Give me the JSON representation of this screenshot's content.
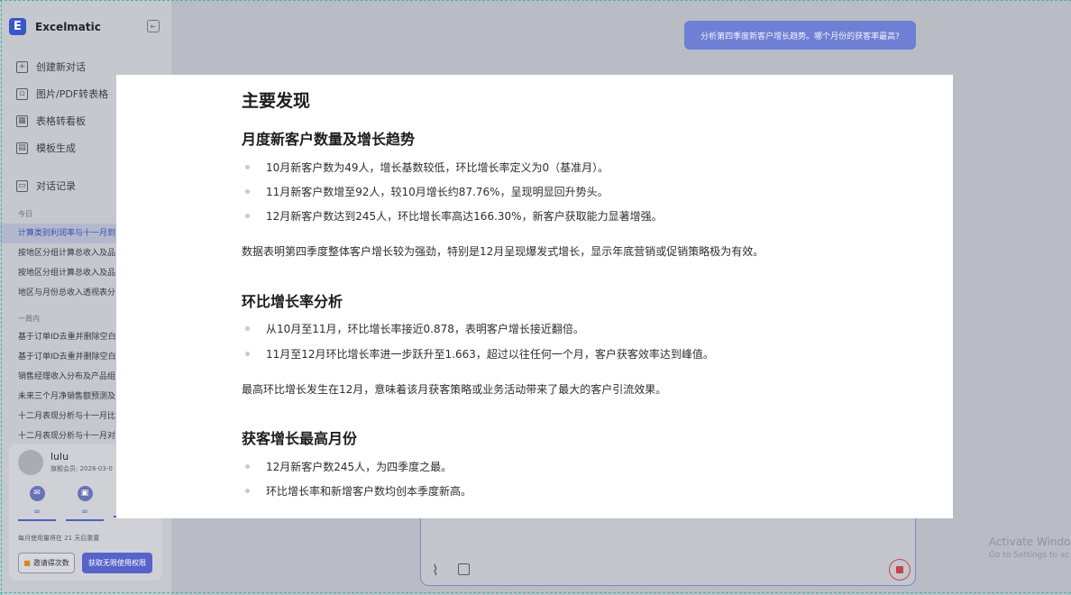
{
  "app": {
    "name": "Excelmatic",
    "logo_letter": "E"
  },
  "sidebar": {
    "menu": [
      {
        "icon": "plus-square-icon",
        "label": "创建新对话"
      },
      {
        "icon": "image-icon",
        "label": "图片/PDF转表格"
      },
      {
        "icon": "dashboard-icon",
        "label": "表格转看板"
      },
      {
        "icon": "template-icon",
        "label": "模板生成"
      }
    ],
    "history_title": "对话记录",
    "sections": [
      {
        "label": "今日",
        "items": [
          "计算类别利润率与十一月到",
          "按地区分组计算总收入及品",
          "按地区分组计算总收入及品",
          "地区与月份总收入透视表分"
        ]
      },
      {
        "label": "一周内",
        "items": [
          "基于订单ID去重并删除空白",
          "基于订单ID去重并删除空白",
          "销售经理收入分布及产品组",
          "未来三个月净销售额预测及",
          "十二月表现分析与十一月比",
          "十二月表现分析与十一月对"
        ]
      }
    ]
  },
  "user": {
    "name": "lulu",
    "member_text": "旗舰会员: 2026-03-0",
    "quotas": [
      {
        "icon": "chat-icon",
        "value": "∞"
      },
      {
        "icon": "image-icon",
        "value": "∞"
      },
      {
        "icon": "",
        "value": ""
      }
    ],
    "renew_text": "每月使用量将在 21 天后重置",
    "invite_label": "邀请得次数",
    "unlimited_label": "获取无限使用权限"
  },
  "chat": {
    "user_message": "分析第四季度新客户增长趋势。哪个月份的获客率最高?"
  },
  "modal": {
    "title": "主要发现",
    "sections": [
      {
        "heading": "月度新客户数量及增长趋势",
        "bullets": [
          "10月新客户数为49人，增长基数较低，环比增长率定义为0（基准月）。",
          "11月新客户数增至92人，较10月增长约87.76%，呈现明显回升势头。",
          "12月新客户数达到245人，环比增长率高达166.30%，新客户获取能力显著增强。"
        ],
        "paragraph": "数据表明第四季度整体客户增长较为强劲，特别是12月呈现爆发式增长，显示年底营销或促销策略极为有效。"
      },
      {
        "heading": "环比增长率分析",
        "bullets": [
          "从10月至11月，环比增长率接近0.878，表明客户增长接近翻倍。",
          "11月至12月环比增长率进一步跃升至1.663，超过以往任何一个月，客户获客效率达到峰值。"
        ],
        "paragraph": "最高环比增长发生在12月，意味着该月获客策略或业务活动带来了最大的客户引流效果。"
      },
      {
        "heading": "获客增长最高月份",
        "bullets": [
          "12月新客户数245人，为四季度之最。",
          "环比增长率和新增客户数均创本季度新高。"
        ],
        "paragraph": ""
      }
    ]
  },
  "watermark": {
    "line1": "Activate Windo",
    "line2": "Go to Settings to ac"
  }
}
